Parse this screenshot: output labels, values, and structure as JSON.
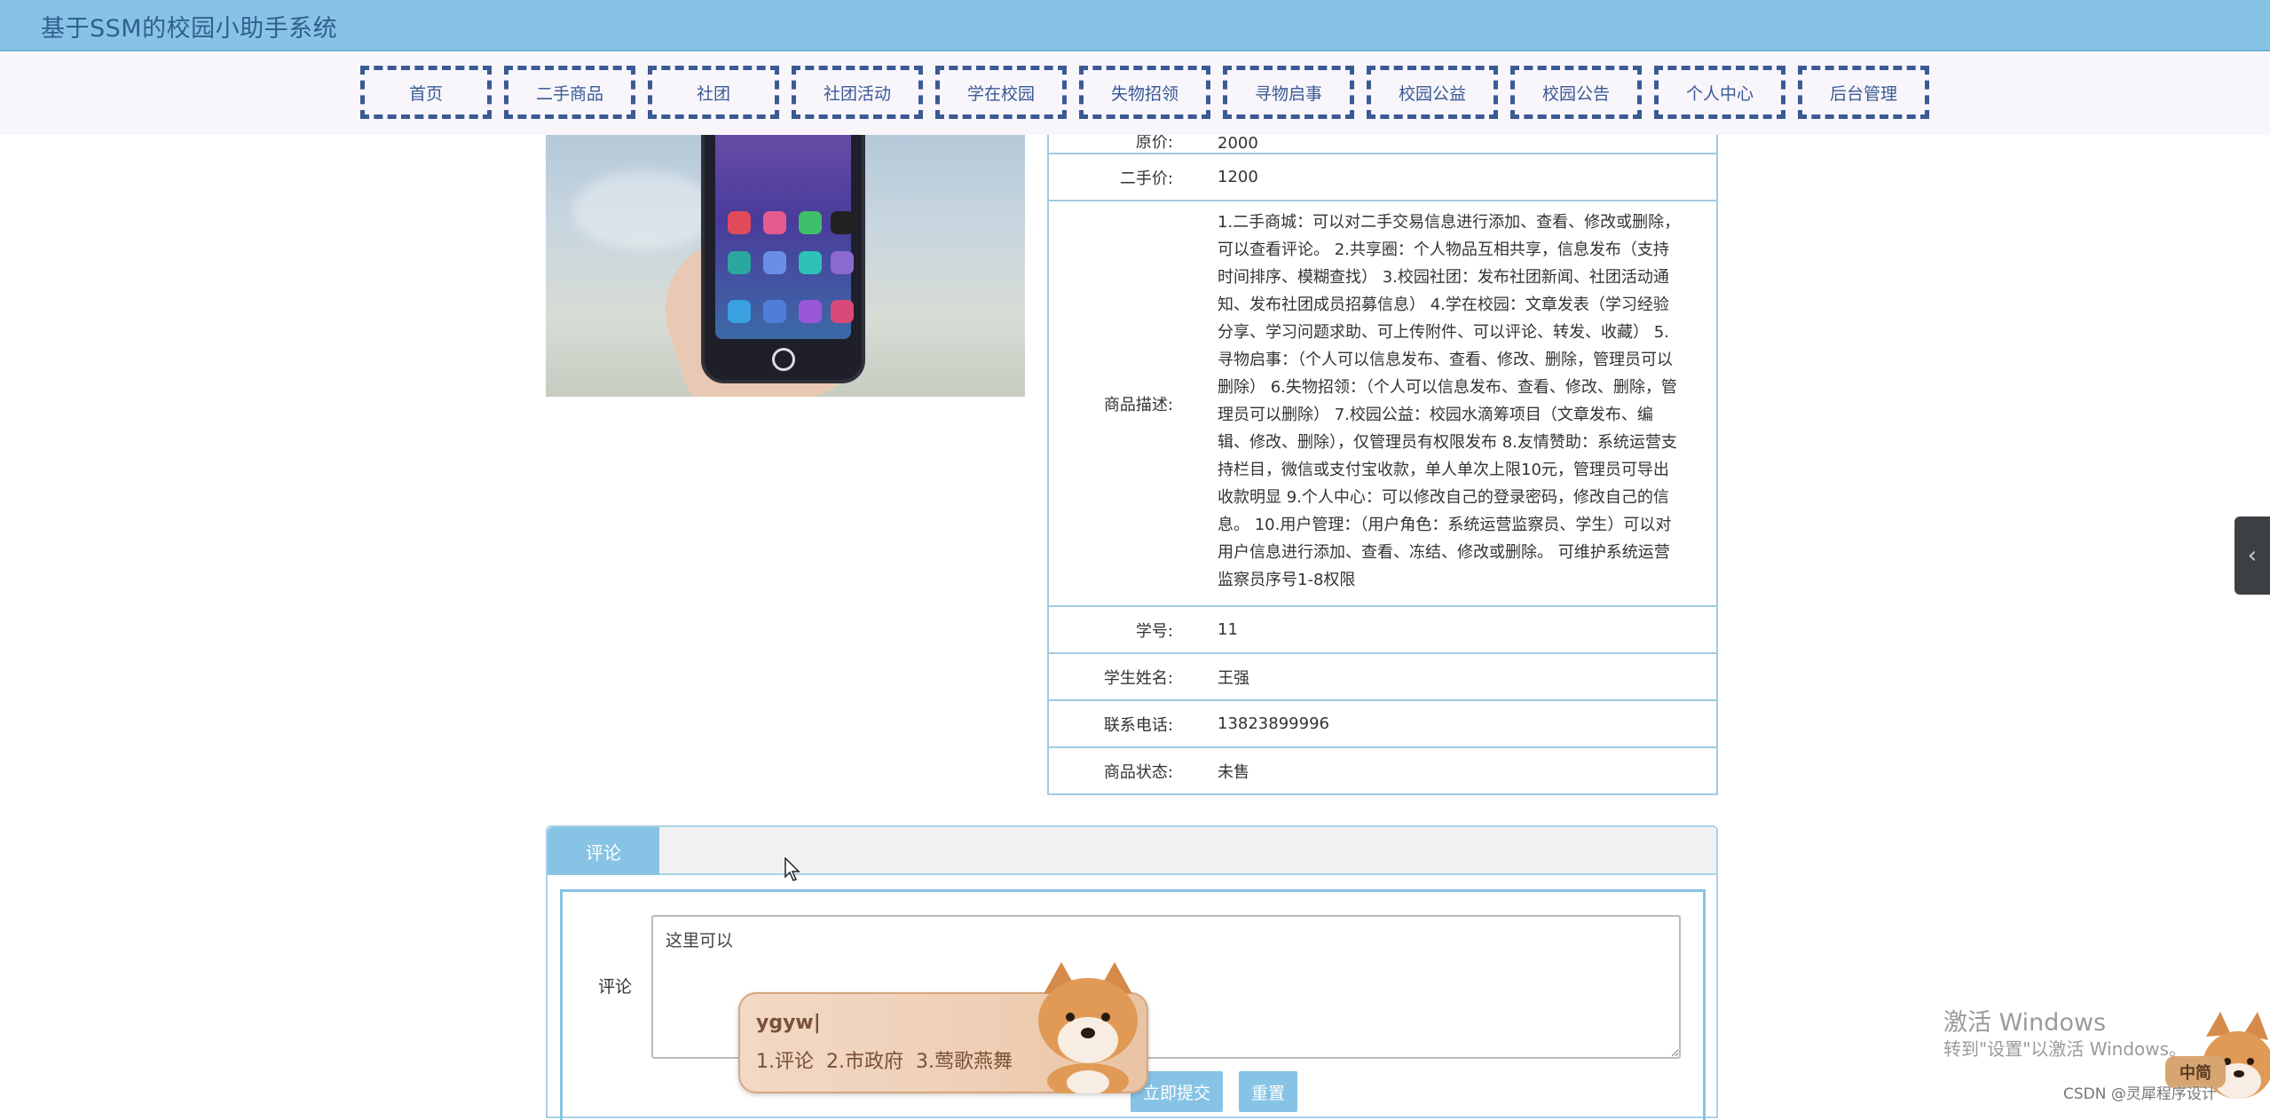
{
  "header": {
    "title": "基于SSM的校园小助手系统"
  },
  "nav": {
    "items": [
      {
        "label": "首页",
        "w": 148
      },
      {
        "label": "二手商品",
        "w": 148
      },
      {
        "label": "社团",
        "w": 148
      },
      {
        "label": "社团活动",
        "w": 148
      },
      {
        "label": "学在校园",
        "w": 148
      },
      {
        "label": "失物招领",
        "w": 148
      },
      {
        "label": "寻物启事",
        "w": 148
      },
      {
        "label": "校园公益",
        "w": 148
      },
      {
        "label": "校园公告",
        "w": 148
      },
      {
        "label": "个人中心",
        "w": 148
      },
      {
        "label": "后台管理",
        "w": 148
      }
    ]
  },
  "detail": {
    "partial_label": "原价:",
    "partial_value": "2000",
    "rows": [
      {
        "label": "二手价:",
        "value": "1200"
      },
      {
        "label": "商品描述:",
        "value": "1.二手商城：可以对二手交易信息进行添加、查看、修改或删除，可以查看评论。 2.共享圈：个人物品互相共享，信息发布（支持时间排序、模糊查找） 3.校园社团：发布社团新闻、社团活动通知、发布社团成员招募信息） 4.学在校园：文章发表（学习经验分享、学习问题求助、可上传附件、可以评论、转发、收藏） 5.寻物启事：（个人可以信息发布、查看、修改、删除，管理员可以删除） 6.失物招领：（个人可以信息发布、查看、修改、删除，管理员可以删除） 7.校园公益：校园水滴筹项目（文章发布、编辑、修改、删除），仅管理员有权限发布 8.友情赞助：系统运营支持栏目，微信或支付宝收款，单人单次上限10元，管理员可导出收款明显 9.个人中心：可以修改自己的登录密码，修改自己的信息。 10.用户管理：（用户角色：系统运营监察员、学生）可以对用户信息进行添加、查看、冻结、修改或删除。 可维护系统运营监察员序号1-8权限"
      },
      {
        "label": "学号:",
        "value": "11"
      },
      {
        "label": "学生姓名:",
        "value": "王强"
      },
      {
        "label": "联系电话:",
        "value": "13823899996"
      },
      {
        "label": "商品状态:",
        "value": "未售"
      }
    ]
  },
  "comment": {
    "tab_label": "评论",
    "field_label": "评论",
    "textarea_value": "这里可以",
    "submit_label": "立即提交",
    "reset_label": "重置"
  },
  "ime": {
    "input": "ygyw|",
    "candidates": [
      "1.评论",
      "2.市政府",
      "3.莺歌燕舞"
    ],
    "badge": "中简"
  },
  "watermarks": {
    "windows_line1": "激活 Windows",
    "windows_line2": "转到\"设置\"以激活 Windows。",
    "csdn": "CSDN @灵犀程序设计"
  },
  "colors": {
    "header_bg": "#87c3e4",
    "nav_border": "#3a5a94",
    "table_border": "#9fcbe0",
    "button_bg": "#87c3e4"
  },
  "icons": {
    "side_toggle": "chevron-left-icon",
    "cursor": "mouse-pointer-icon"
  }
}
